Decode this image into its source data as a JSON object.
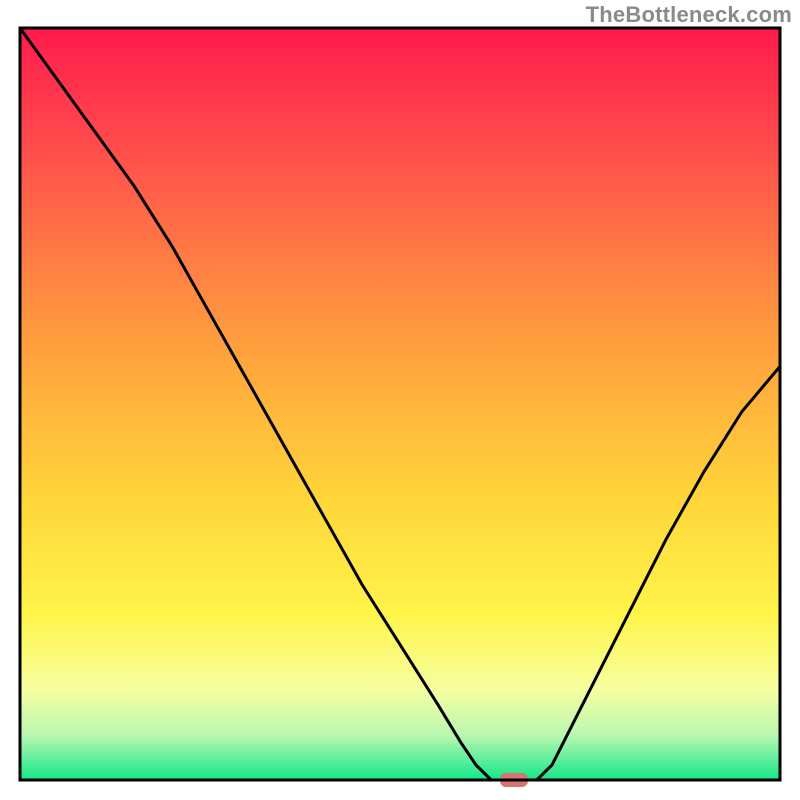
{
  "watermark": "TheBottleneck.com",
  "chart_data": {
    "type": "line",
    "title": "",
    "xlabel": "",
    "ylabel": "",
    "xlim": [
      0,
      100
    ],
    "ylim": [
      0,
      100
    ],
    "grid": false,
    "legend": false,
    "series": [
      {
        "name": "bottleneck-curve",
        "x": [
          0,
          5,
          10,
          15,
          20,
          25,
          30,
          35,
          40,
          45,
          50,
          55,
          58,
          60,
          62,
          64,
          66,
          68,
          70,
          72,
          75,
          80,
          85,
          90,
          95,
          100
        ],
        "y": [
          100,
          93,
          86,
          79,
          71,
          62,
          53,
          44,
          35,
          26,
          18,
          10,
          5,
          2,
          0,
          0,
          0,
          0,
          2,
          6,
          12,
          22,
          32,
          41,
          49,
          55
        ]
      }
    ],
    "marker": {
      "name": "optimal-point",
      "x": 65,
      "y": 0,
      "color": "#d8736e"
    },
    "gradient_stops": [
      {
        "offset": 0.0,
        "color": "#ff1a4d"
      },
      {
        "offset": 0.2,
        "color": "#ff5a4a"
      },
      {
        "offset": 0.42,
        "color": "#ff9f3e"
      },
      {
        "offset": 0.62,
        "color": "#ffd43a"
      },
      {
        "offset": 0.78,
        "color": "#fff44a"
      },
      {
        "offset": 0.88,
        "color": "#f6ffa0"
      },
      {
        "offset": 0.94,
        "color": "#baf7b0"
      },
      {
        "offset": 1.0,
        "color": "#13e78a"
      }
    ]
  }
}
